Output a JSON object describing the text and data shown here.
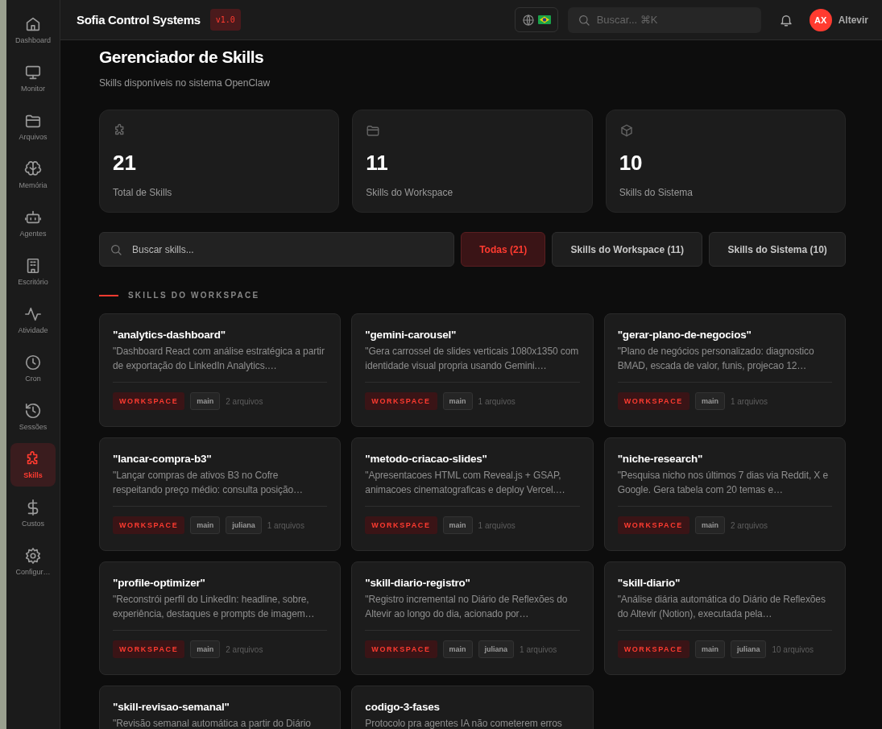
{
  "app": {
    "title": "Sofia Control Systems",
    "version": "v1.0"
  },
  "topbar": {
    "search_placeholder": "Buscar... ⌘K",
    "user": {
      "initials": "AX",
      "name": "Altevir"
    }
  },
  "sidebar": {
    "items": [
      {
        "label": "Dashboard",
        "selected": false
      },
      {
        "label": "Monitor",
        "selected": false
      },
      {
        "label": "Arquivos",
        "selected": false
      },
      {
        "label": "Memória",
        "selected": false
      },
      {
        "label": "Agentes",
        "selected": false
      },
      {
        "label": "Escritório",
        "selected": false
      },
      {
        "label": "Atividade",
        "selected": false
      },
      {
        "label": "Cron",
        "selected": false
      },
      {
        "label": "Sessões",
        "selected": false
      },
      {
        "label": "Skills",
        "selected": true
      },
      {
        "label": "Custos",
        "selected": false
      },
      {
        "label": "Configur…",
        "selected": false
      }
    ]
  },
  "page": {
    "title": "Gerenciador de Skills",
    "subtitle": "Skills disponíveis no sistema OpenClaw"
  },
  "stats": [
    {
      "value": "21",
      "label": "Total de Skills"
    },
    {
      "value": "11",
      "label": "Skills do Workspace"
    },
    {
      "value": "10",
      "label": "Skills do Sistema"
    }
  ],
  "filter": {
    "placeholder": "Buscar skills...",
    "tabs": [
      {
        "label": "Todas (21)",
        "selected": true
      },
      {
        "label": "Skills do Workspace (11)",
        "selected": false
      },
      {
        "label": "Skills do Sistema (10)",
        "selected": false
      }
    ]
  },
  "section_title": "SKILLS DO WORKSPACE",
  "skills": [
    {
      "name": "\"analytics-dashboard\"",
      "description": "\"Dashboard React com análise estratégica a partir de exportação do LinkedIn Analytics.…",
      "badge": "WORKSPACE",
      "tags": [
        "main"
      ],
      "files": "2 arquivos"
    },
    {
      "name": "\"gemini-carousel\"",
      "description": "\"Gera carrossel de slides verticais 1080x1350 com identidade visual propria usando Gemini.…",
      "badge": "WORKSPACE",
      "tags": [
        "main"
      ],
      "files": "1 arquivos"
    },
    {
      "name": "\"gerar-plano-de-negocios\"",
      "description": "\"Plano de negócios personalizado: diagnostico BMAD, escada de valor, funis, projecao 12…",
      "badge": "WORKSPACE",
      "tags": [
        "main"
      ],
      "files": "1 arquivos"
    },
    {
      "name": "\"lancar-compra-b3\"",
      "description": "\"Lançar compras de ativos B3 no Cofre respeitando preço médio: consulta posição…",
      "badge": "WORKSPACE",
      "tags": [
        "main",
        "juliana"
      ],
      "files": "1 arquivos"
    },
    {
      "name": "\"metodo-criacao-slides\"",
      "description": "\"Apresentacoes HTML com Reveal.js + GSAP, animacoes cinematograficas e deploy Vercel.…",
      "badge": "WORKSPACE",
      "tags": [
        "main"
      ],
      "files": "1 arquivos"
    },
    {
      "name": "\"niche-research\"",
      "description": "\"Pesquisa nicho nos últimos 7 dias via Reddit, X e Google. Gera tabela com 20 temas e…",
      "badge": "WORKSPACE",
      "tags": [
        "main"
      ],
      "files": "2 arquivos"
    },
    {
      "name": "\"profile-optimizer\"",
      "description": "\"Reconstrói perfil do LinkedIn: headline, sobre, experiência, destaques e prompts de imagem…",
      "badge": "WORKSPACE",
      "tags": [
        "main"
      ],
      "files": "2 arquivos"
    },
    {
      "name": "\"skill-diario-registro\"",
      "description": "\"Registro incremental no Diário de Reflexões do Altevir ao longo do dia, acionado por…",
      "badge": "WORKSPACE",
      "tags": [
        "main",
        "juliana"
      ],
      "files": "1 arquivos"
    },
    {
      "name": "\"skill-diario\"",
      "description": "\"Análise diária automática do Diário de Reflexões do Altevir (Notion), executada pela…",
      "badge": "WORKSPACE",
      "tags": [
        "main",
        "juliana"
      ],
      "files": "10 arquivos"
    },
    {
      "name": "\"skill-revisao-semanal\"",
      "description": "\"Revisão semanal automática a partir do Diário"
    },
    {
      "name": "codigo-3-fases",
      "description": "Protocolo pra agentes IA não cometerem erros"
    }
  ]
}
